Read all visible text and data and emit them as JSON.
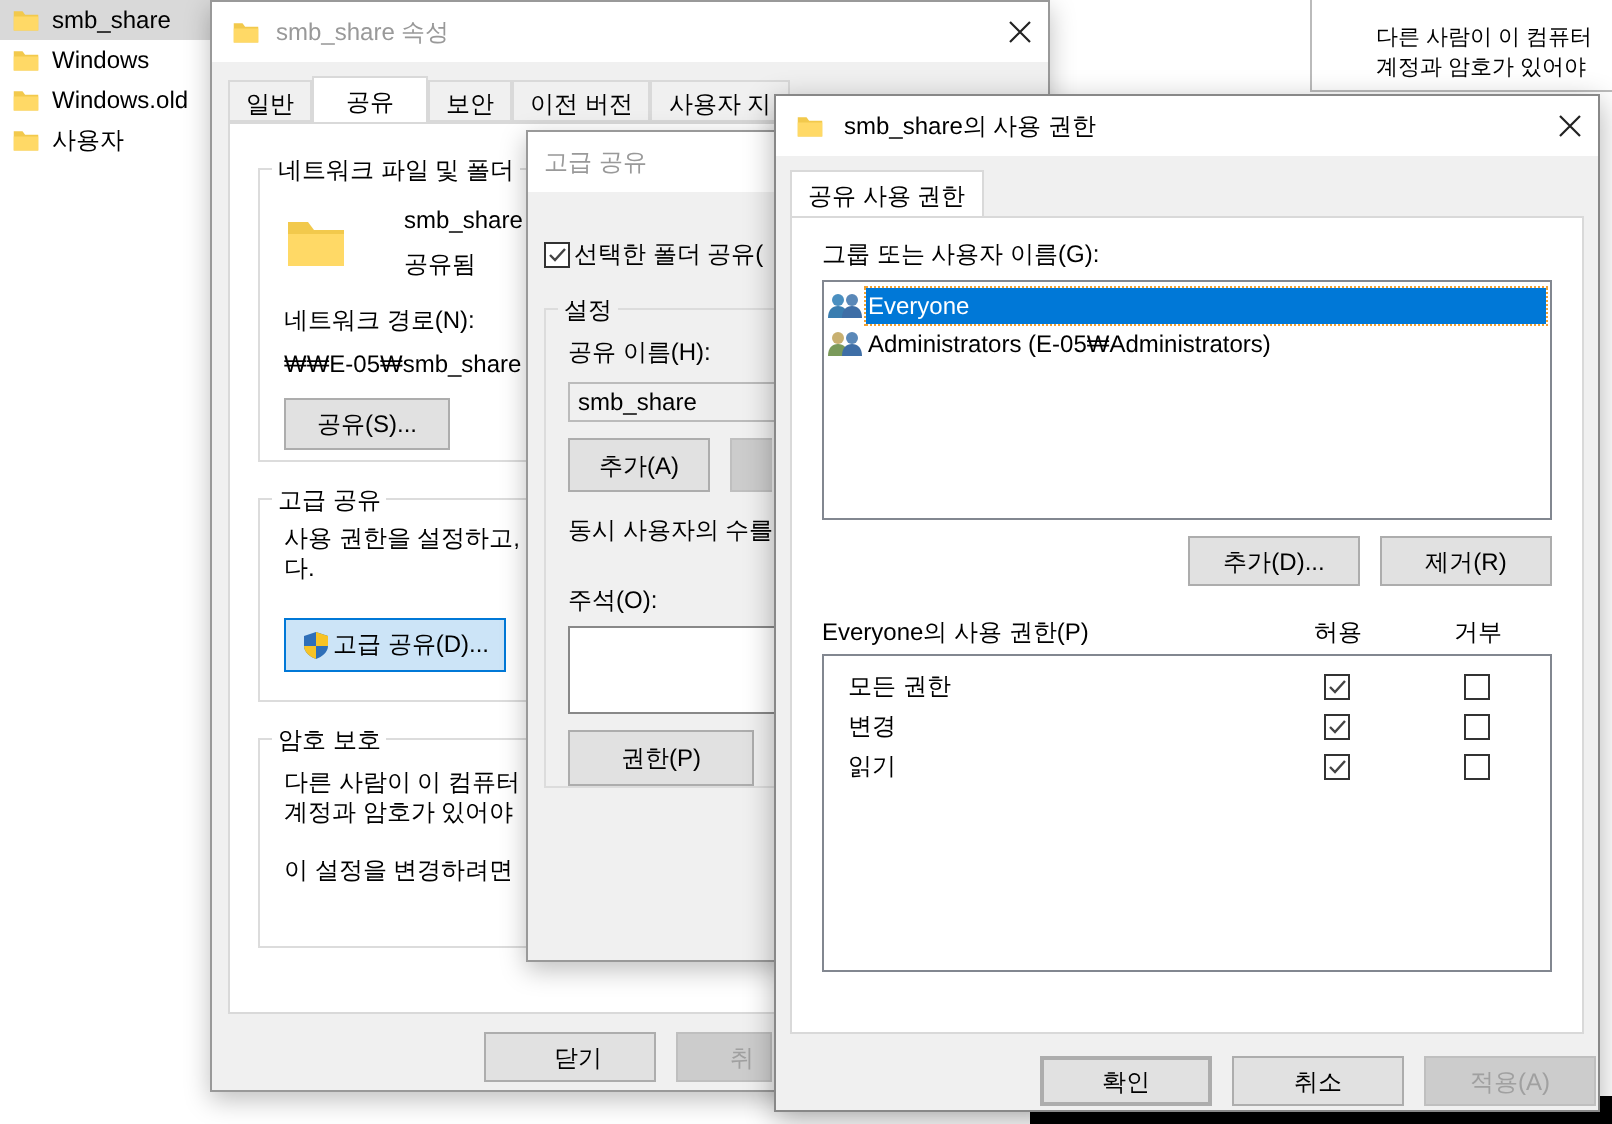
{
  "explorer": {
    "items": [
      {
        "label": "smb_share",
        "selected": true
      },
      {
        "label": "Windows",
        "selected": false
      },
      {
        "label": "Windows.old",
        "selected": false
      },
      {
        "label": "사용자",
        "selected": false
      }
    ]
  },
  "background_window": {
    "lines": [
      "다른 사람이 이 컴퓨터",
      "계정과 암호가 있어야"
    ]
  },
  "properties": {
    "title": "smb_share 속성",
    "tabs": [
      {
        "label": "일반",
        "selected": false
      },
      {
        "label": "공유",
        "selected": true
      },
      {
        "label": "보안",
        "selected": false
      },
      {
        "label": "이전 버전",
        "selected": false
      },
      {
        "label": "사용자 지",
        "selected": false
      }
    ],
    "network_group": {
      "title": "네트워크 파일 및 폴더",
      "folder_name": "smb_share",
      "folder_status": "공유됨",
      "path_label": "네트워크 경로(N):",
      "path": "₩₩E-05₩smb_share",
      "share_button": "공유(S)..."
    },
    "advanced_group": {
      "title": "고급 공유",
      "lines": [
        "사용 권한을 설정하고,",
        "다."
      ],
      "button": "고급 공유(D)..."
    },
    "password_group": {
      "title": "암호 보호",
      "lines": [
        "다른 사람이 이 컴퓨터",
        "계정과 암호가 있어야"
      ],
      "note": "이 설정을 변경하려면"
    },
    "buttons": [
      {
        "label": "닫기",
        "disabled": false
      },
      {
        "label": "취",
        "disabled": true
      }
    ]
  },
  "advanced": {
    "title": "고급 공유",
    "share_checkbox": {
      "label": "선택한 폴더 공유(",
      "checked": true
    },
    "settings_title": "설정",
    "share_name_label": "공유 이름(H):",
    "share_name": "smb_share",
    "add_button": "추가(A)",
    "users_label": "동시 사용자의 수를",
    "comment_label": "주석(O):",
    "permissions_button": "권한(P)"
  },
  "permissions": {
    "title": "smb_share의 사용 권한",
    "tab": {
      "label": "공유 사용 권한",
      "selected": true
    },
    "users_label": "그룹 또는 사용자 이름(G):",
    "users": [
      {
        "name": "Everyone",
        "selected": true
      },
      {
        "name": "Administrators (E-05₩Administrators)",
        "selected": false
      }
    ],
    "user_buttons": [
      "추가(D)...",
      "제거(R)"
    ],
    "perm_label": "Everyone의 사용 권한(P)",
    "columns": [
      "허용",
      "거부"
    ],
    "rows": [
      {
        "name": "모든 권한",
        "allow": true,
        "deny": false
      },
      {
        "name": "변경",
        "allow": true,
        "deny": false
      },
      {
        "name": "읽기",
        "allow": true,
        "deny": false
      }
    ],
    "buttons": [
      {
        "label": "확인",
        "default": true,
        "disabled": false
      },
      {
        "label": "취소",
        "default": false,
        "disabled": false
      },
      {
        "label": "적용(A)",
        "default": false,
        "disabled": true
      }
    ]
  }
}
